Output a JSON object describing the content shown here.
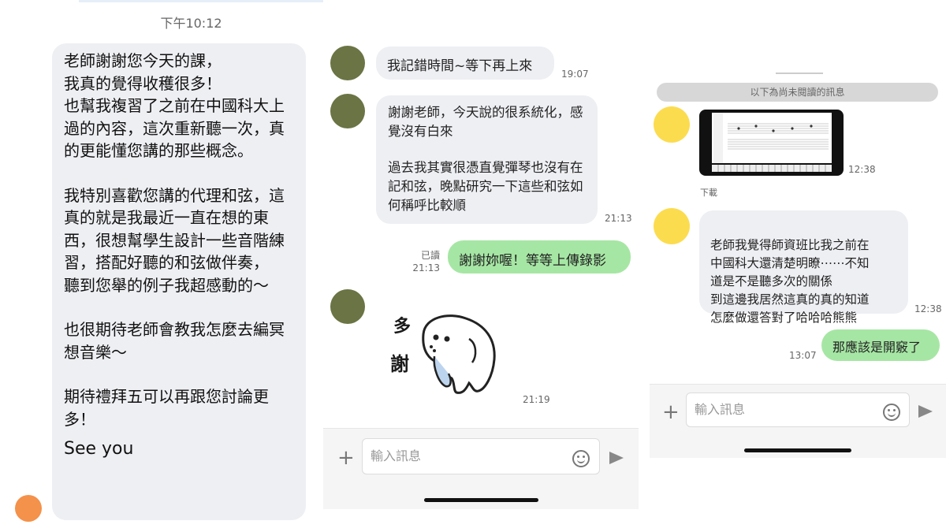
{
  "panel1": {
    "time_header": "下午10:12",
    "message_paragraphs": [
      "老師謝謝您今天的課，\n我真的覺得收穫很多！\n也幫我複習了之前在中國科大上過的內容，這次重新聽一次，真的更能懂您講的那些概念。",
      "我特別喜歡您講的代理和弦，這真的就是我最近一直在想的東西，很想幫學生設計一些音階練習，搭配好聽的和弦做伴奏，\n聽到您舉的例子我超感動的～",
      "也很期待老師會教我怎麼去編冥想音樂～",
      "期待禮拜五可以再跟您討論更多！"
    ],
    "message_closing": "See you"
  },
  "panel2": {
    "msg1": "我記錯時間~等下再上來",
    "msg1_time": "19:07",
    "msg2_part1": "謝謝老師，今天說的很系統化，感覺沒有白來",
    "msg2_part2": "過去我其實很憑直覺彈琴也沒有在記和弦，晚點研究一下這些和弦如何稱呼比較順",
    "msg2_time": "21:13",
    "read_label": "已讀",
    "read_time": "21:13",
    "reply": "謝謝妳喔！等等上傳錄影",
    "sticker_text_1": "多",
    "sticker_text_2": "謝",
    "sticker_time": "21:19",
    "input_placeholder": "輸入訊息"
  },
  "panel3": {
    "unread_divider": "以下為尚未閱讀的訊息",
    "video_time": "12:38",
    "download_label": "下載",
    "msg": "老師我覺得師資班比我之前在\n中國科大還清楚明瞭⋯⋯不知\n道是不是聽多次的關係\n到這邊我居然這真的真的知道\n怎麼做還答對了哈哈哈熊熊",
    "msg_time": "12:38",
    "reply": "那應該是開竅了",
    "reply_time": "13:07",
    "input_placeholder": "輸入訊息"
  },
  "colors": {
    "incoming_bubble": "#eeeff3",
    "outgoing_bubble": "#a6e6a4",
    "avatar_orange": "#f4914a",
    "avatar_olive": "#6a7444",
    "avatar_yellow": "#fcdc4f"
  }
}
